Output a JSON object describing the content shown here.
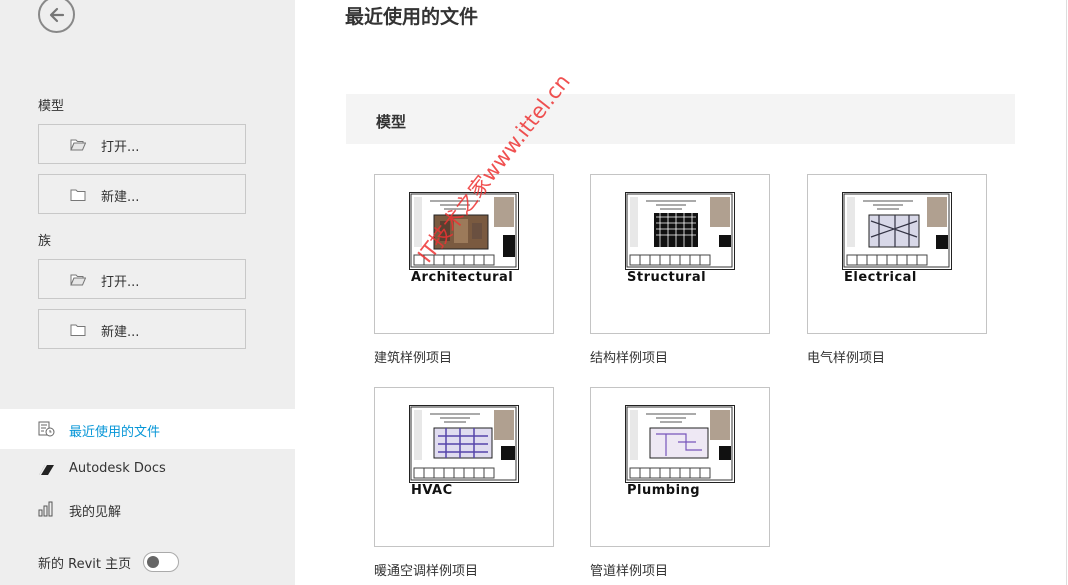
{
  "sidebar": {
    "models_label": "模型",
    "models_open": "打开...",
    "models_new": "新建...",
    "families_label": "族",
    "families_open": "打开...",
    "families_new": "新建...",
    "nav": {
      "recent": "最近使用的文件",
      "docs": "Autodesk Docs",
      "insights": "我的见解"
    },
    "toggle_label": "新的 Revit 主页",
    "toggle_on": false
  },
  "main": {
    "title": "最近使用的文件",
    "section_title": "模型",
    "cards": [
      {
        "label": "建筑样例项目",
        "thumb_text": "Architectural"
      },
      {
        "label": "结构样例项目",
        "thumb_text": "Structural"
      },
      {
        "label": "电气样例项目",
        "thumb_text": "Electrical"
      },
      {
        "label": "暖通空调样例项目",
        "thumb_text": "HVAC"
      },
      {
        "label": "管道样例项目",
        "thumb_text": "Plumbing"
      }
    ]
  },
  "watermark": "IT技术之家www.ittel.cn",
  "colors": {
    "accent": "#0696d7",
    "sidebar_bg": "#eeeeee",
    "watermark": "#ee3333"
  }
}
